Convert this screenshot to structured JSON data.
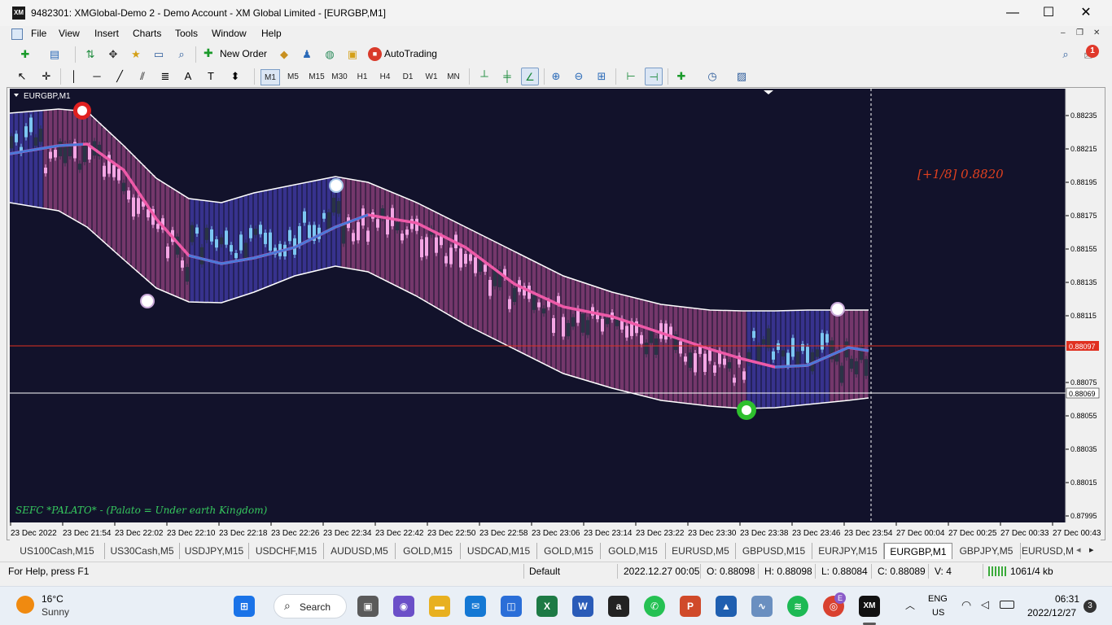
{
  "window": {
    "app_logo": "XM",
    "title": "9482301: XMGlobal-Demo 2 - Demo Account - XM Global Limited - [EURGBP,M1]",
    "controls": {
      "minimize": "—",
      "maximize": "☐",
      "close": "✕"
    }
  },
  "menu": {
    "items": [
      "File",
      "View",
      "Insert",
      "Charts",
      "Tools",
      "Window",
      "Help"
    ],
    "mdi": {
      "minimize": "–",
      "restore": "❐",
      "close": "✕"
    }
  },
  "toolbar": {
    "new_order": "New Order",
    "autotrading": "AutoTrading",
    "notification_count": "1",
    "timeframes": [
      "M1",
      "M5",
      "M15",
      "M30",
      "H1",
      "H4",
      "D1",
      "W1",
      "MN"
    ],
    "active_timeframe": "M1",
    "icons": [
      "new-chart-icon",
      "profiles-icon",
      "market-watch-icon",
      "navigator-icon",
      "favorites-icon",
      "terminal-icon",
      "strategy-tester-icon",
      "new-order-icon",
      "metaeditor-icon",
      "signals-icon",
      "market-icon",
      "vps-icon",
      "autotrading-icon",
      "search-icon",
      "chat-icon",
      "cursor-icon",
      "crosshair-icon",
      "vertical-line-icon",
      "horizontal-line-icon",
      "trendline-icon",
      "equidistant-channel-icon",
      "fibonacci-icon",
      "text-icon",
      "text-label-icon",
      "arrows-icon",
      "bar-chart-icon",
      "candlestick-icon",
      "line-chart-icon",
      "zoom-in-icon",
      "zoom-out-icon",
      "tile-windows-icon",
      "chart-shift-icon",
      "autoscroll-icon",
      "indicators-icon",
      "periods-icon",
      "templates-icon"
    ]
  },
  "chart": {
    "symbol_label": "EURGBP,M1",
    "colors": {
      "background": "#12122b",
      "band_purple": "#7a3a6f",
      "band_blue": "#3a3592",
      "ma_pink": "#ee5aa8",
      "ma_blue": "#4a78d8",
      "candle_pink": "#f4a6e4",
      "candle_light_blue": "#7cc6f2",
      "candle_dark": "#2a3446",
      "envelope": "#ffffff",
      "bid_line": "#e03020",
      "fib_text": "#e0401f",
      "signature_text": "#36c95e"
    },
    "fib_label": "[+1/8] 0.8820",
    "signature": "SEFC *PALATO* - (Palato = Under earth Kingdom)",
    "price_axis": [
      "0.88235",
      "0.88215",
      "0.88195",
      "0.88175",
      "0.88155",
      "0.88135",
      "0.88115",
      "0.88075",
      "0.88055",
      "0.88035",
      "0.88015",
      "0.87995"
    ],
    "bid_price": "0.88097",
    "ask_price": "0.88069",
    "time_axis": [
      "23 Dec 2022",
      "23 Dec 21:54",
      "23 Dec 22:02",
      "23 Dec 22:10",
      "23 Dec 22:18",
      "23 Dec 22:26",
      "23 Dec 22:34",
      "23 Dec 22:42",
      "23 Dec 22:50",
      "23 Dec 22:58",
      "23 Dec 23:06",
      "23 Dec 23:14",
      "23 Dec 23:22",
      "23 Dec 23:30",
      "23 Dec 23:38",
      "23 Dec 23:46",
      "23 Dec 23:54",
      "27 Dec 00:04",
      "27 Dec 00:25",
      "27 Dec 00:33",
      "27 Dec 00:43"
    ]
  },
  "tabs": {
    "items": [
      "US100Cash,M15",
      "US30Cash,M5",
      "USDJPY,M15",
      "USDCHF,M15",
      "AUDUSD,M5",
      "GOLD,M15",
      "USDCAD,M15",
      "GOLD,M15",
      "GOLD,M15",
      "EURUSD,M5",
      "GBPUSD,M15",
      "EURJPY,M15",
      "EURGBP,M1",
      "GBPJPY,M5",
      "EURUSD,M"
    ],
    "active": "EURGBP,M1",
    "scroll_left": "◂",
    "scroll_right": "▸"
  },
  "status": {
    "help": "For Help, press F1",
    "profile": "Default",
    "datetime": "2022.12.27 00:05",
    "open": "O: 0.88098",
    "high": "H: 0.88098",
    "low": "L: 0.88084",
    "close": "C: 0.88089",
    "volume": "V: 4",
    "traffic": "1061/4 kb"
  },
  "taskbar": {
    "weather_temp": "16°C",
    "weather_desc": "Sunny",
    "search": "Search",
    "apps": [
      {
        "name": "start-icon",
        "label": "⊞",
        "color": "#1a73e8"
      },
      {
        "name": "task-view-icon",
        "label": "▣",
        "color": "#5a5a5a"
      },
      {
        "name": "chat-app-icon",
        "label": "◉",
        "color": "#6b4fc8"
      },
      {
        "name": "file-explorer-icon",
        "label": "▬",
        "color": "#e8b020"
      },
      {
        "name": "mail-icon",
        "label": "✉",
        "color": "#1478d4"
      },
      {
        "name": "store-icon",
        "label": "◫",
        "color": "#2a6ed8"
      },
      {
        "name": "excel-icon",
        "label": "X",
        "color": "#1d7a45"
      },
      {
        "name": "word-icon",
        "label": "W",
        "color": "#2a5bb8"
      },
      {
        "name": "amazon-icon",
        "label": "a",
        "color": "#222222"
      },
      {
        "name": "whatsapp-icon",
        "label": "✆",
        "color": "#25c153"
      },
      {
        "name": "powerpoint-icon",
        "label": "P",
        "color": "#d04a2a"
      },
      {
        "name": "edu-app-icon",
        "label": "▲",
        "color": "#1f5fb0"
      },
      {
        "name": "stocks-app-icon",
        "label": "∿",
        "color": "#6a8fc0"
      },
      {
        "name": "spotify-icon",
        "label": "≋",
        "color": "#1db954"
      },
      {
        "name": "chrome-icon",
        "label": "◎",
        "color": "#d9412f"
      },
      {
        "name": "xm-app-icon",
        "label": "XM",
        "color": "#111111"
      }
    ],
    "lang_top": "ENG",
    "lang_bottom": "US",
    "time": "06:31",
    "date": "2022/12/27",
    "notification_count": "3",
    "chrome_badge": "E"
  }
}
